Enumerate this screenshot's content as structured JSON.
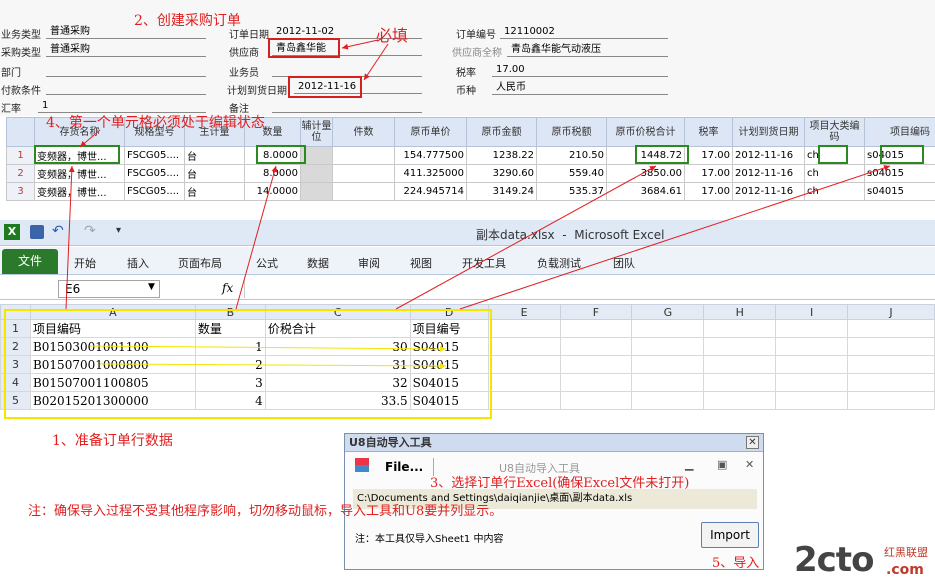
{
  "order_form": {
    "fields": [
      {
        "label": "业务类型",
        "value": "普通采购"
      },
      {
        "label": "采购类型",
        "value": "普通采购"
      },
      {
        "label": "部门",
        "value": ""
      },
      {
        "label": "付款条件",
        "value": ""
      },
      {
        "label": "汇率",
        "value": "1"
      },
      {
        "label": "订单日期",
        "value": "2012-11-02"
      },
      {
        "label": "供应商",
        "value": "青岛鑫华能"
      },
      {
        "label": "业务员",
        "value": ""
      },
      {
        "label": "计划到货日期",
        "value": "2012-11-16"
      },
      {
        "label": "备注",
        "value": ""
      },
      {
        "label": "订单编号",
        "value": "12110002"
      },
      {
        "label": "供应商全称",
        "value": "青岛鑫华能气动液压"
      },
      {
        "label": "税率",
        "value": "17.00"
      },
      {
        "label": "币种",
        "value": "人民币"
      }
    ]
  },
  "order_grid": {
    "headers": [
      "",
      "存货名称",
      "规格型号",
      "主计量",
      "数量",
      "辅计量位",
      "件数",
      "原币单价",
      "原币金额",
      "原币税额",
      "原币价税合计",
      "税率",
      "计划到货日期",
      "项目大类编码",
      "项目编码"
    ],
    "rows": [
      [
        "1",
        "变频器，博世...",
        "FSCG05....",
        "台",
        "8.0000",
        "",
        "",
        "154.777500",
        "1238.22",
        "210.50",
        "1448.72",
        "17.00",
        "2012-11-16",
        "ch",
        "s04015"
      ],
      [
        "2",
        "变频器，博世...",
        "FSCG05....",
        "台",
        "8.0000",
        "",
        "",
        "411.325000",
        "3290.60",
        "559.40",
        "3850.00",
        "17.00",
        "2012-11-16",
        "ch",
        "s04015"
      ],
      [
        "3",
        "变频器，博世...",
        "FSCG05....",
        "台",
        "14.0000",
        "",
        "",
        "224.945714",
        "3149.24",
        "535.37",
        "3684.61",
        "17.00",
        "2012-11-16",
        "ch",
        "s04015"
      ]
    ]
  },
  "excel": {
    "window_title": "副本data.xlsx  -  Microsoft Excel",
    "tabs": [
      "文件",
      "开始",
      "插入",
      "页面布局",
      "公式",
      "数据",
      "审阅",
      "视图",
      "开发工具",
      "负载测试",
      "团队"
    ],
    "name_box": "E6",
    "fx": "fx",
    "columns": [
      "A",
      "B",
      "C",
      "D",
      "E",
      "F",
      "G",
      "H",
      "I",
      "J"
    ],
    "rows": [
      [
        "1",
        "项目编码",
        "数量",
        "价税合计",
        "项目编号"
      ],
      [
        "2",
        "B01503001001100",
        "1",
        "30",
        "S04015"
      ],
      [
        "3",
        "B01507001000800",
        "2",
        "31",
        "S04015"
      ],
      [
        "4",
        "B01507001100805",
        "3",
        "32",
        "S04015"
      ],
      [
        "5",
        "B02015201300000",
        "4",
        "33.5",
        "S04015"
      ]
    ]
  },
  "tool": {
    "title": "U8自动导入工具",
    "file_menu": "File...",
    "inner_title": "U8自动导入工具",
    "path": "C:\\Documents and Settings\\daiqianjie\\桌面\\副本data.xls",
    "note": "注：本工具仅导入Sheet1 中内容",
    "import_label": "Import"
  },
  "annotations": {
    "step1": "1、准备订单行数据",
    "step2": "2、创建采购订单",
    "required": "必填",
    "step3": "3、选择订单行Excel(确保Excel文件未打开)",
    "step4": "4、第一个单元格必须处于编辑状态",
    "step5": "5、导入",
    "note": "注：确保导入过程不受其他程序影响，切勿移动鼠标，导入工具和U8要并列显示。"
  },
  "watermark": {
    "main": "2cto",
    "sub1": "红黑联盟",
    "sub2": ".com"
  },
  "colors": {
    "annotation": "#e02020",
    "highlight_green": "#2b8a1e",
    "excel_file_tab": "#2b7a2b",
    "excel_select": "#f5e600"
  }
}
